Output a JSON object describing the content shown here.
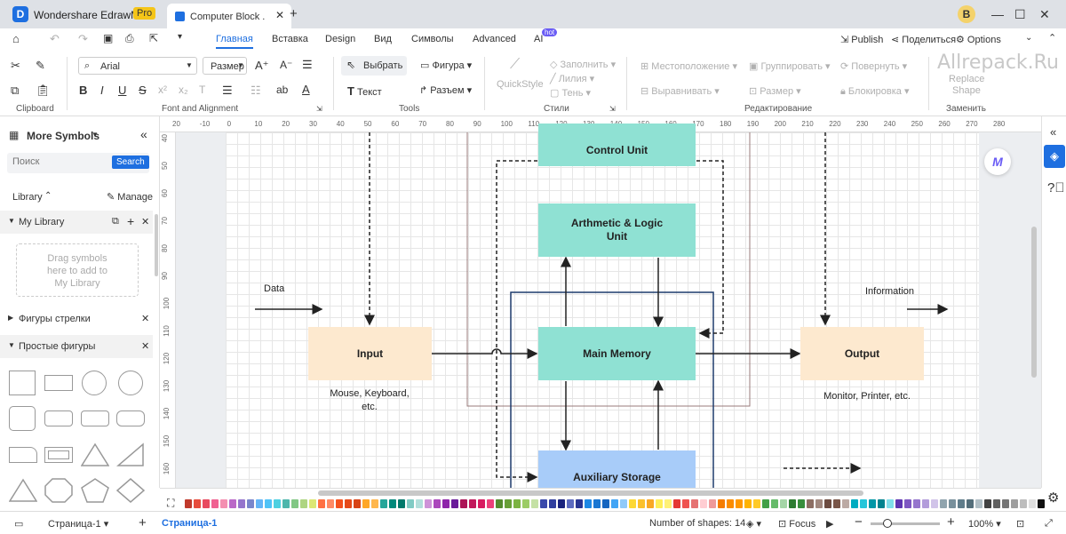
{
  "app": {
    "name": "Wondershare EdrawMax",
    "badge": "Pro"
  },
  "tab": {
    "title": "Computer Block ..."
  },
  "user_avatar": "B",
  "menu": [
    "Главная",
    "Вставка",
    "Design",
    "Вид",
    "Символы",
    "Advanced",
    "AI"
  ],
  "ai_badge": "hot",
  "menu_right": {
    "publish": "Publish",
    "share": "Поделиться",
    "options": "Options"
  },
  "ribbon": {
    "font": "Arial",
    "size": "Размер",
    "select": "Выбрать",
    "shape": "Фигура",
    "text": "Текст",
    "connector": "Разъем",
    "quickstyle": "QuickStyle",
    "fill": "Заполнить",
    "line": "Лилия",
    "shadow": "Тень",
    "position": "Местоположение",
    "align": "Выравнивать",
    "group": "Группировать",
    "rotate": "Повернуть",
    "lock": "Блокировка",
    "replace1": "Replace",
    "replace2": "Shape",
    "groups": {
      "clipboard": "Clipboard",
      "font": "Font and Alignment",
      "tools": "Tools",
      "styles": "Стили",
      "edit": "Редактирование",
      "replace": "Заменить"
    }
  },
  "watermark": "Allrepack.Ru",
  "left": {
    "title": "More Symbols",
    "search_placeholder": "Поиск",
    "search_button": "Search",
    "library": "Library",
    "manage": "Manage",
    "my_library": "My Library",
    "drop1": "Drag symbols",
    "drop2": "here to add to",
    "drop3": "My Library",
    "arrows": "Фигуры стрелки",
    "simple": "Простые фигуры"
  },
  "ruler_h": [
    "20",
    "-10",
    "0",
    "10",
    "20",
    "30",
    "40",
    "50",
    "60",
    "70",
    "80",
    "90",
    "100",
    "110",
    "120",
    "130",
    "140",
    "150",
    "160",
    "170",
    "180",
    "190",
    "200",
    "210",
    "220",
    "230",
    "240",
    "250",
    "260",
    "270",
    "280"
  ],
  "ruler_v": [
    "40",
    "50",
    "60",
    "70",
    "80",
    "90",
    "100",
    "110",
    "120",
    "130",
    "140",
    "150",
    "160"
  ],
  "diagram": {
    "control_unit": "Control Unit",
    "alu1": "Arthmetic & Logic",
    "alu2": "Unit",
    "main_memory": "Main Memory",
    "input": "Input",
    "output": "Output",
    "aux": "Auxiliary Storage",
    "data": "Data",
    "information": "Information",
    "input_cap1": "Mouse, Keyboard,",
    "input_cap2": "etc.",
    "output_cap": "Monitor, Printer, etc."
  },
  "colors": {
    "accent": "#1e6fe0",
    "control": "#8fe1d3",
    "memory": "#8fe1d3",
    "io": "#fde9cf",
    "aux": "#a8ccf9"
  },
  "status": {
    "page_tab": "Страница-1",
    "page_active": "Страница-1",
    "shapes": "Number of shapes: 14",
    "focus": "Focus",
    "zoom": "100%"
  }
}
